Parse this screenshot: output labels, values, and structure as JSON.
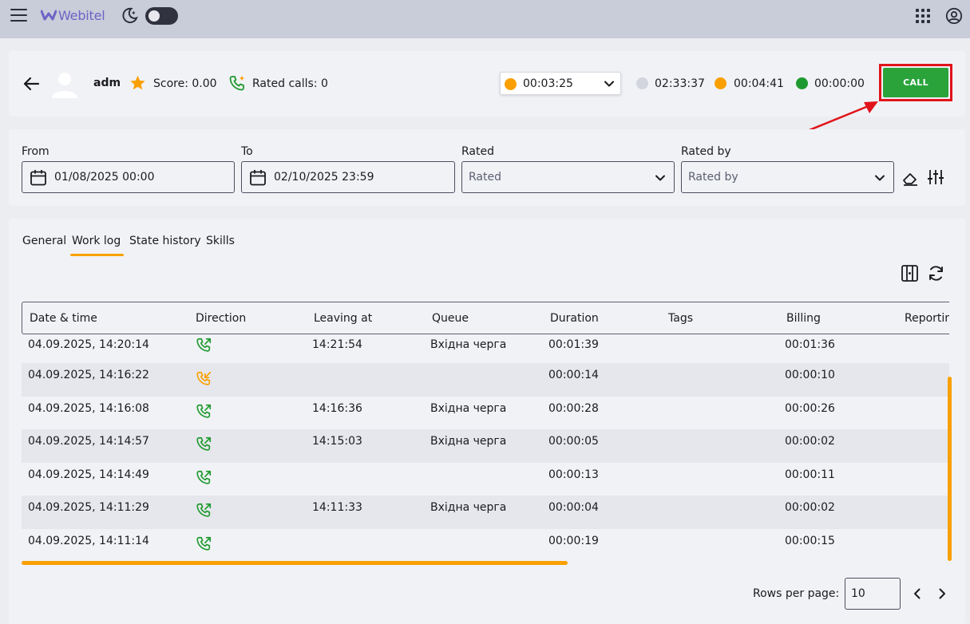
{
  "header": {
    "logo_text": "Webitel",
    "theme_toggle": "off",
    "icons": [
      "menu-icon",
      "webitel-logo",
      "moon-icon",
      "apps-grid-icon",
      "account-circle-icon"
    ]
  },
  "agent": {
    "name": "adm",
    "score_label": "Score: 0.00",
    "rated_calls_label": "Rated calls: 0",
    "status_time": "00:03:25",
    "status_color": "#f9a000",
    "timers": [
      {
        "time": "02:33:37",
        "color": "#d3d5de"
      },
      {
        "time": "00:04:41",
        "color": "#f9a000"
      },
      {
        "time": "00:00:00",
        "color": "#1f9a30"
      }
    ],
    "call_button": "CALL",
    "call_button_color": "#2aa33b",
    "highlight_color": "#e1131a"
  },
  "filters": {
    "from_label": "From",
    "from_value": "01/08/2025 00:00",
    "to_label": "To",
    "to_value": "02/10/2025 23:59",
    "rated_label": "Rated",
    "rated_placeholder": "Rated",
    "rated_by_label": "Rated by",
    "rated_by_placeholder": "Rated by"
  },
  "tabs": [
    {
      "label": "General"
    },
    {
      "label": "Work log",
      "active": true
    },
    {
      "label": "State history"
    },
    {
      "label": "Skills"
    }
  ],
  "table": {
    "columns": [
      "Date & time",
      "Direction",
      "Leaving at",
      "Queue",
      "Duration",
      "Tags",
      "Billing",
      "Reportin"
    ],
    "rows": [
      {
        "datetime": "04.09.2025, 14:20:14",
        "direction": "outbound",
        "leaving_at": "14:21:54",
        "queue": "Вхідна черга",
        "duration": "00:01:39",
        "tags": "",
        "billing": "00:01:36"
      },
      {
        "datetime": "04.09.2025, 14:16:22",
        "direction": "missed",
        "leaving_at": "",
        "queue": "",
        "duration": "00:00:14",
        "tags": "",
        "billing": "00:00:10"
      },
      {
        "datetime": "04.09.2025, 14:16:08",
        "direction": "outbound",
        "leaving_at": "14:16:36",
        "queue": "Вхідна черга",
        "duration": "00:00:28",
        "tags": "",
        "billing": "00:00:26"
      },
      {
        "datetime": "04.09.2025, 14:14:57",
        "direction": "outbound",
        "leaving_at": "14:15:03",
        "queue": "Вхідна черга",
        "duration": "00:00:05",
        "tags": "",
        "billing": "00:00:02"
      },
      {
        "datetime": "04.09.2025, 14:14:49",
        "direction": "outbound",
        "leaving_at": "",
        "queue": "",
        "duration": "00:00:13",
        "tags": "",
        "billing": "00:00:11"
      },
      {
        "datetime": "04.09.2025, 14:11:29",
        "direction": "outbound",
        "leaving_at": "14:11:33",
        "queue": "Вхідна черга",
        "duration": "00:00:04",
        "tags": "",
        "billing": "00:00:02"
      },
      {
        "datetime": "04.09.2025, 14:11:14",
        "direction": "outbound",
        "leaving_at": "",
        "queue": "",
        "duration": "00:00:19",
        "tags": "",
        "billing": "00:00:15"
      }
    ]
  },
  "pagination": {
    "rows_per_page_label": "Rows per page:",
    "rows_per_page_value": "10"
  }
}
